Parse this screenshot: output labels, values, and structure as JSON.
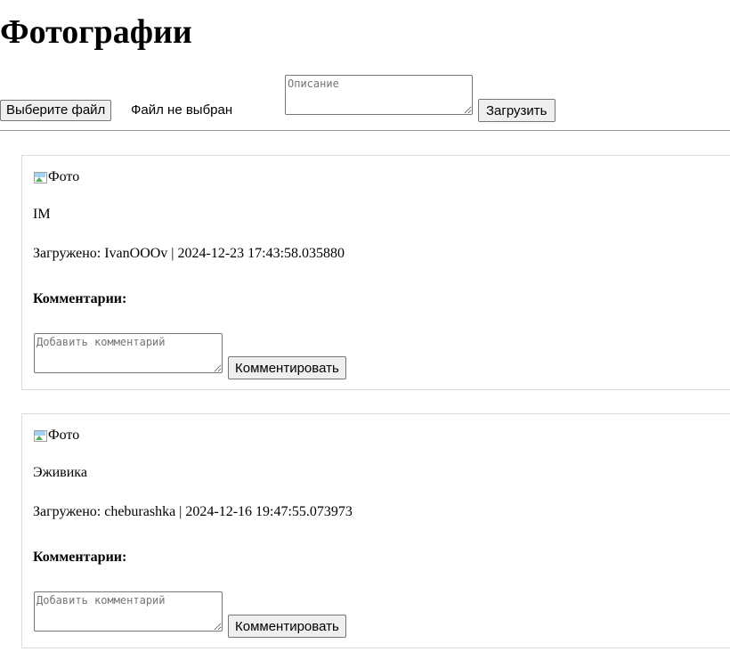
{
  "page": {
    "title": "Фотографии"
  },
  "upload": {
    "file_button": "Выберите файл",
    "file_status": "Файл не выбран",
    "description_placeholder": "Описание",
    "submit_label": "Загрузить"
  },
  "photos": [
    {
      "image_alt": "Фото",
      "caption": "IM",
      "meta": "Загружено: IvanOOOv | 2024-12-23 17:43:58.035880",
      "comments_title": "Комментарии:",
      "comment_placeholder": "Добавить комментарий",
      "comment_button": "Комментировать"
    },
    {
      "image_alt": "Фото",
      "caption": "Эживика",
      "meta": "Загружено: cheburashka | 2024-12-16 19:47:55.073973",
      "comments_title": "Комментарии:",
      "comment_placeholder": "Добавить комментарий",
      "comment_button": "Комментировать"
    }
  ]
}
